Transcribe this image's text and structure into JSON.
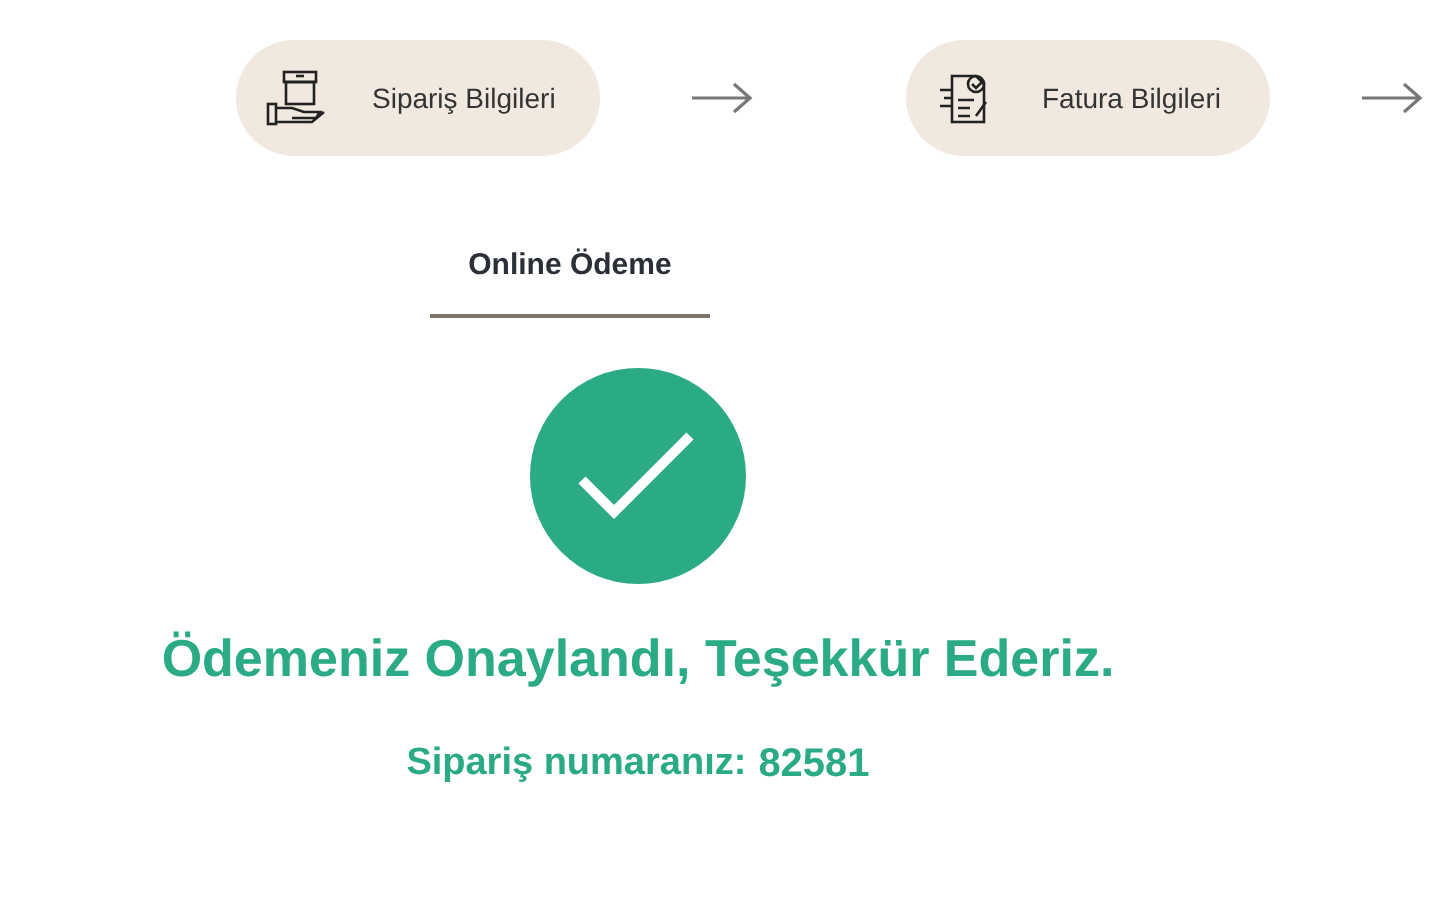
{
  "steps": [
    {
      "label": "Sipariş Bilgileri",
      "kind": "box"
    },
    {
      "label": "Fatura Bilgileri",
      "kind": "invoice"
    }
  ],
  "tabs": [
    {
      "label": "Online Ödeme",
      "selected": true
    }
  ],
  "result": {
    "confirmed": true,
    "title": "Ödemeniz Onaylandı, Teşekkür Ederiz.",
    "order_label": "Sipariş numaranız:",
    "order_number": "82581"
  }
}
